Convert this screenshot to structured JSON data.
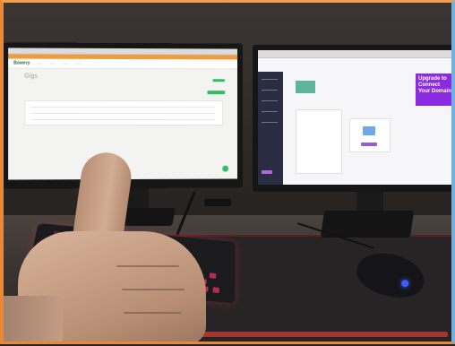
{
  "scene": "desk-setup-thumbs-up",
  "left_monitor": {
    "app_logo": "Bowery",
    "page_title": "Gigs"
  },
  "right_monitor": {
    "promo": "Upgrade to Connect Your Domain"
  },
  "colors": {
    "accent_green": "#2fbf5c",
    "promo_purple": "#8a2be2",
    "keyboard_glow": "#d0305c",
    "mouse_led": "#3f5cff"
  }
}
